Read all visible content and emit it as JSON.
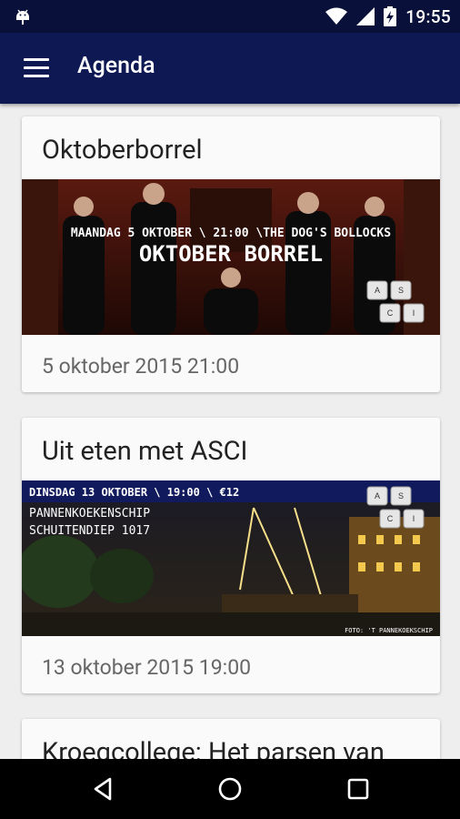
{
  "status_bar": {
    "time": "19:55",
    "icons": [
      "android-debug-icon",
      "wifi-icon",
      "signal-icon",
      "battery-charging-icon"
    ]
  },
  "app_bar": {
    "title": "Agenda",
    "menu_icon": "hamburger-menu-icon"
  },
  "events": [
    {
      "title": "Oktoberborrel",
      "date": "5 oktober 2015 21:00",
      "banner": {
        "line1": "MAANDAG 5 OKTOBER \\ 21:00 \\THE DOG'S BOLLOCKS",
        "line2": "OKTOBER BORREL",
        "logo": [
          "A",
          "S",
          "C",
          "I"
        ]
      }
    },
    {
      "title": "Uit eten met ASCI",
      "date": "13 oktober 2015 19:00",
      "banner": {
        "line1": "DINSDAG 13 OKTOBER \\ 19:00 \\ €12",
        "line2": "PANNENKOEKENSCHIP",
        "line3": "SCHUITENDIEP 1017",
        "credit": "FOTO: 'T PANNEKOEKSCHIP",
        "logo": [
          "A",
          "S",
          "C",
          "I"
        ]
      }
    },
    {
      "title": "Kroegcollege: Het parsen van"
    }
  ],
  "nav_bar": {
    "buttons": [
      "back-icon",
      "home-icon",
      "recents-icon"
    ]
  },
  "colors": {
    "status_bar": "#09103a",
    "app_bar": "#0e1852",
    "background": "#eeeeee",
    "card": "#fafafa"
  }
}
